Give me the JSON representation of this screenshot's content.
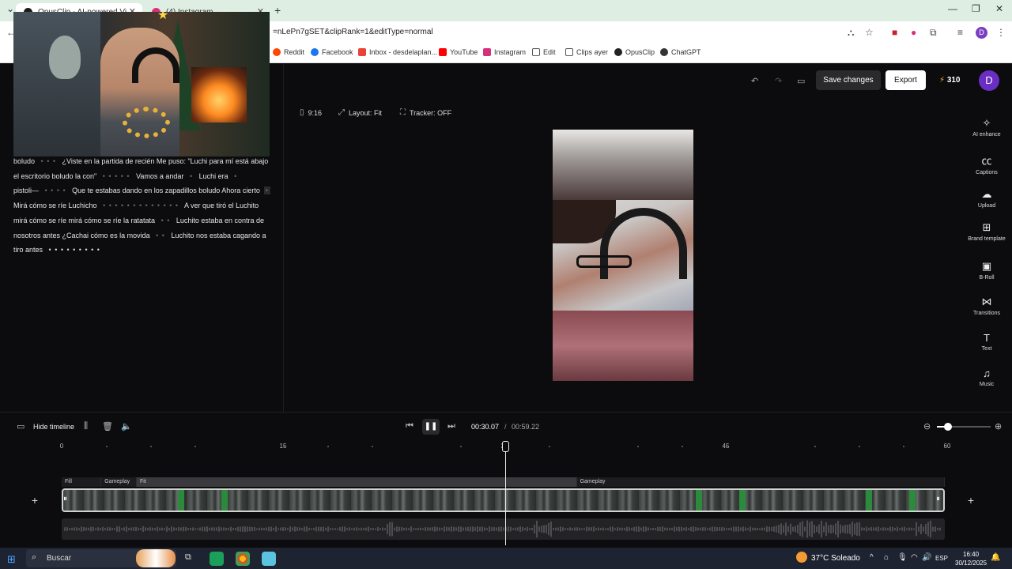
{
  "browser": {
    "tabs": [
      {
        "label": "OpusClip - AI-powered Vi",
        "active": true
      },
      {
        "label": "(4) Instagram",
        "active": false
      }
    ],
    "url": "=nLePn7gSET&clipRank=1&editType=normal",
    "profile_initial": "D",
    "bookmarks": [
      "Reddit",
      "Facebook",
      "Inbox - desdelaplan...",
      "YouTube",
      "Instagram",
      "Edit",
      "Clips ayer",
      "OpusClip",
      "ChatGPT"
    ]
  },
  "transcript": {
    "segments": [
      {
        "text": "boludo",
        "type": "text"
      },
      {
        "text": "• • •",
        "type": "dots"
      },
      {
        "text": "¿Viste en la partida de recién Me puso: \"Luchi para mí está abajo el escritorio boludo la con\"",
        "type": "text"
      },
      {
        "text": "• • • • •",
        "type": "dots"
      },
      {
        "text": "Vamos a andar",
        "type": "text"
      },
      {
        "text": "•",
        "type": "dots"
      },
      {
        "text": "Luchi era",
        "type": "text"
      },
      {
        "text": "•",
        "type": "dots"
      },
      {
        "text": "pistoli—",
        "type": "text"
      },
      {
        "text": "• • • •",
        "type": "dots"
      },
      {
        "text": "Que te estabas dando en los zapadillos boludo Ahora cierto",
        "type": "text"
      },
      {
        "text": "•",
        "type": "hl"
      },
      {
        "text": "Mirá cómo se ríe Luchicho",
        "type": "text"
      },
      {
        "text": "• • • • • • • • • • • • •",
        "type": "dots"
      },
      {
        "text": "A ver que tiró el Luchito mirá cómo se ríe mirá cómo se ríe la ratatata",
        "type": "text"
      },
      {
        "text": "• •",
        "type": "dots"
      },
      {
        "text": "Luchito estaba en contra de nosotros antes ¿Cachai cómo es la movida",
        "type": "text"
      },
      {
        "text": "• •",
        "type": "dots"
      },
      {
        "text": "Luchito nos estaba cagando a tiro antes",
        "type": "text"
      },
      {
        "text": "• • • • • • • • •",
        "type": "bright"
      }
    ]
  },
  "editor": {
    "save_label": "Save changes",
    "export_label": "Export",
    "credits": "310",
    "avatar_initial": "D",
    "aspect": "9:16",
    "layout": "Layout: Fit",
    "tracker": "Tracker: OFF"
  },
  "tools": [
    {
      "label": "AI enhance",
      "icon": "✧"
    },
    {
      "label": "Captions",
      "icon": "㏄"
    },
    {
      "label": "Upload",
      "icon": "☁"
    },
    {
      "label": "Brand template",
      "icon": "⊞"
    },
    {
      "label": "B-Roll",
      "icon": "▣"
    },
    {
      "label": "Transitions",
      "icon": "⋈"
    },
    {
      "label": "Text",
      "icon": "T"
    },
    {
      "label": "Music",
      "icon": "♫"
    }
  ],
  "timeline": {
    "hide_label": "Hide timeline",
    "current_time": "00:30.07",
    "separator": "/",
    "total_time": "00:59.22",
    "ruler_labels": [
      "0",
      "15",
      "30",
      "45",
      "60"
    ],
    "zoom_level": 0.2,
    "playhead_seconds": 30.07,
    "duration_seconds": 60,
    "segments": [
      {
        "label": "Fill",
        "start": 0,
        "end": 2.7
      },
      {
        "label": "Gameplay",
        "start": 2.7,
        "end": 5.1
      },
      {
        "label": "Fit",
        "start": 5.1,
        "end": 35.0
      },
      {
        "label": "Gameplay",
        "start": 35.0,
        "end": 60
      }
    ]
  },
  "taskbar": {
    "search_label": "Buscar",
    "weather": "37°C  Soleado",
    "language": "ESP",
    "time": "16:40",
    "date": "30/12/2025"
  }
}
